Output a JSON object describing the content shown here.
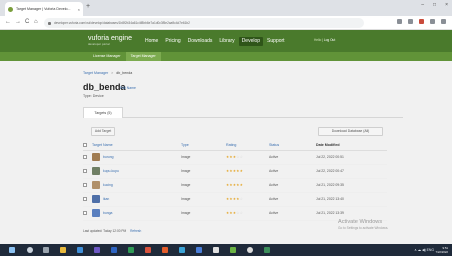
{
  "browser": {
    "tab_title": "Target Manager | Vuforia Develo...",
    "tab_close": "×",
    "new_tab": "+",
    "window_controls": [
      "–",
      "□",
      "×"
    ],
    "nav": {
      "back": "←",
      "forward": "→",
      "reload": "C",
      "home": "⌂"
    },
    "url": "developer.vuforia.com/vui/develop/databases/1b8f2b34a61c4f8bb6e7a1d0c3f5e2aa9c4d7e61b2"
  },
  "header": {
    "logo": "vuforia engine",
    "logo_sub": "developer portal",
    "nav": [
      "Home",
      "Pricing",
      "Downloads",
      "Library",
      "Develop",
      "Support"
    ],
    "active_nav": "Develop",
    "account_label": "Hello ",
    "account_user": "",
    "account_logout": "Log Out"
  },
  "subnav": {
    "items": [
      "License Manager",
      "Target Manager"
    ],
    "active": "Target Manager"
  },
  "breadcrumb": {
    "parent": "Target Manager",
    "separator": ">",
    "current": "db_benda"
  },
  "database": {
    "name": "db_benda",
    "edit_link": "Edit Name",
    "type_label": "Type: Device"
  },
  "tabs": {
    "targets": "Targets (5)"
  },
  "actions": {
    "add_target": "Add Target",
    "download_database": "Download Database (All)"
  },
  "table": {
    "headers": [
      "Target Name",
      "Type",
      "Rating",
      "Status",
      "Date Modified"
    ],
    "rows": [
      {
        "name": "burung",
        "type": "Image",
        "rating": 3,
        "status": "Active",
        "date": "Jul 22, 2022 00:51",
        "thumb_color": "#a07c52"
      },
      {
        "name": "kupu-kupu",
        "type": "Image",
        "rating": 5,
        "status": "Active",
        "date": "Jul 22, 2022 00:47",
        "thumb_color": "#6f7f64"
      },
      {
        "name": "kucing",
        "type": "Image",
        "rating": 5,
        "status": "Active",
        "date": "Jul 21, 2022 09:35",
        "thumb_color": "#b0906a"
      },
      {
        "name": "ikan",
        "type": "Image",
        "rating": 4,
        "status": "Active",
        "date": "Jul 21, 2022 13:40",
        "thumb_color": "#4e6fa8"
      },
      {
        "name": "bunga",
        "type": "Image",
        "rating": 3,
        "status": "Active",
        "date": "Jul 21, 2022 13:39",
        "thumb_color": "#5a7fbf"
      }
    ]
  },
  "footer": {
    "note": "Last updated: Today 12:00 PM",
    "refresh": "Refresh"
  },
  "watermark": {
    "line1": "Activate Windows",
    "line2": "Go to Settings to activate Windows."
  },
  "taskbar": {
    "tray": "∧  ☁  ◀)  ENG",
    "time": "9:51",
    "date": "7/22/2022"
  },
  "colors": {
    "header_green": "#4a7a2c",
    "subnav_green": "#619338",
    "link_blue": "#3a6fb0",
    "star_gold": "#e4a11b"
  }
}
